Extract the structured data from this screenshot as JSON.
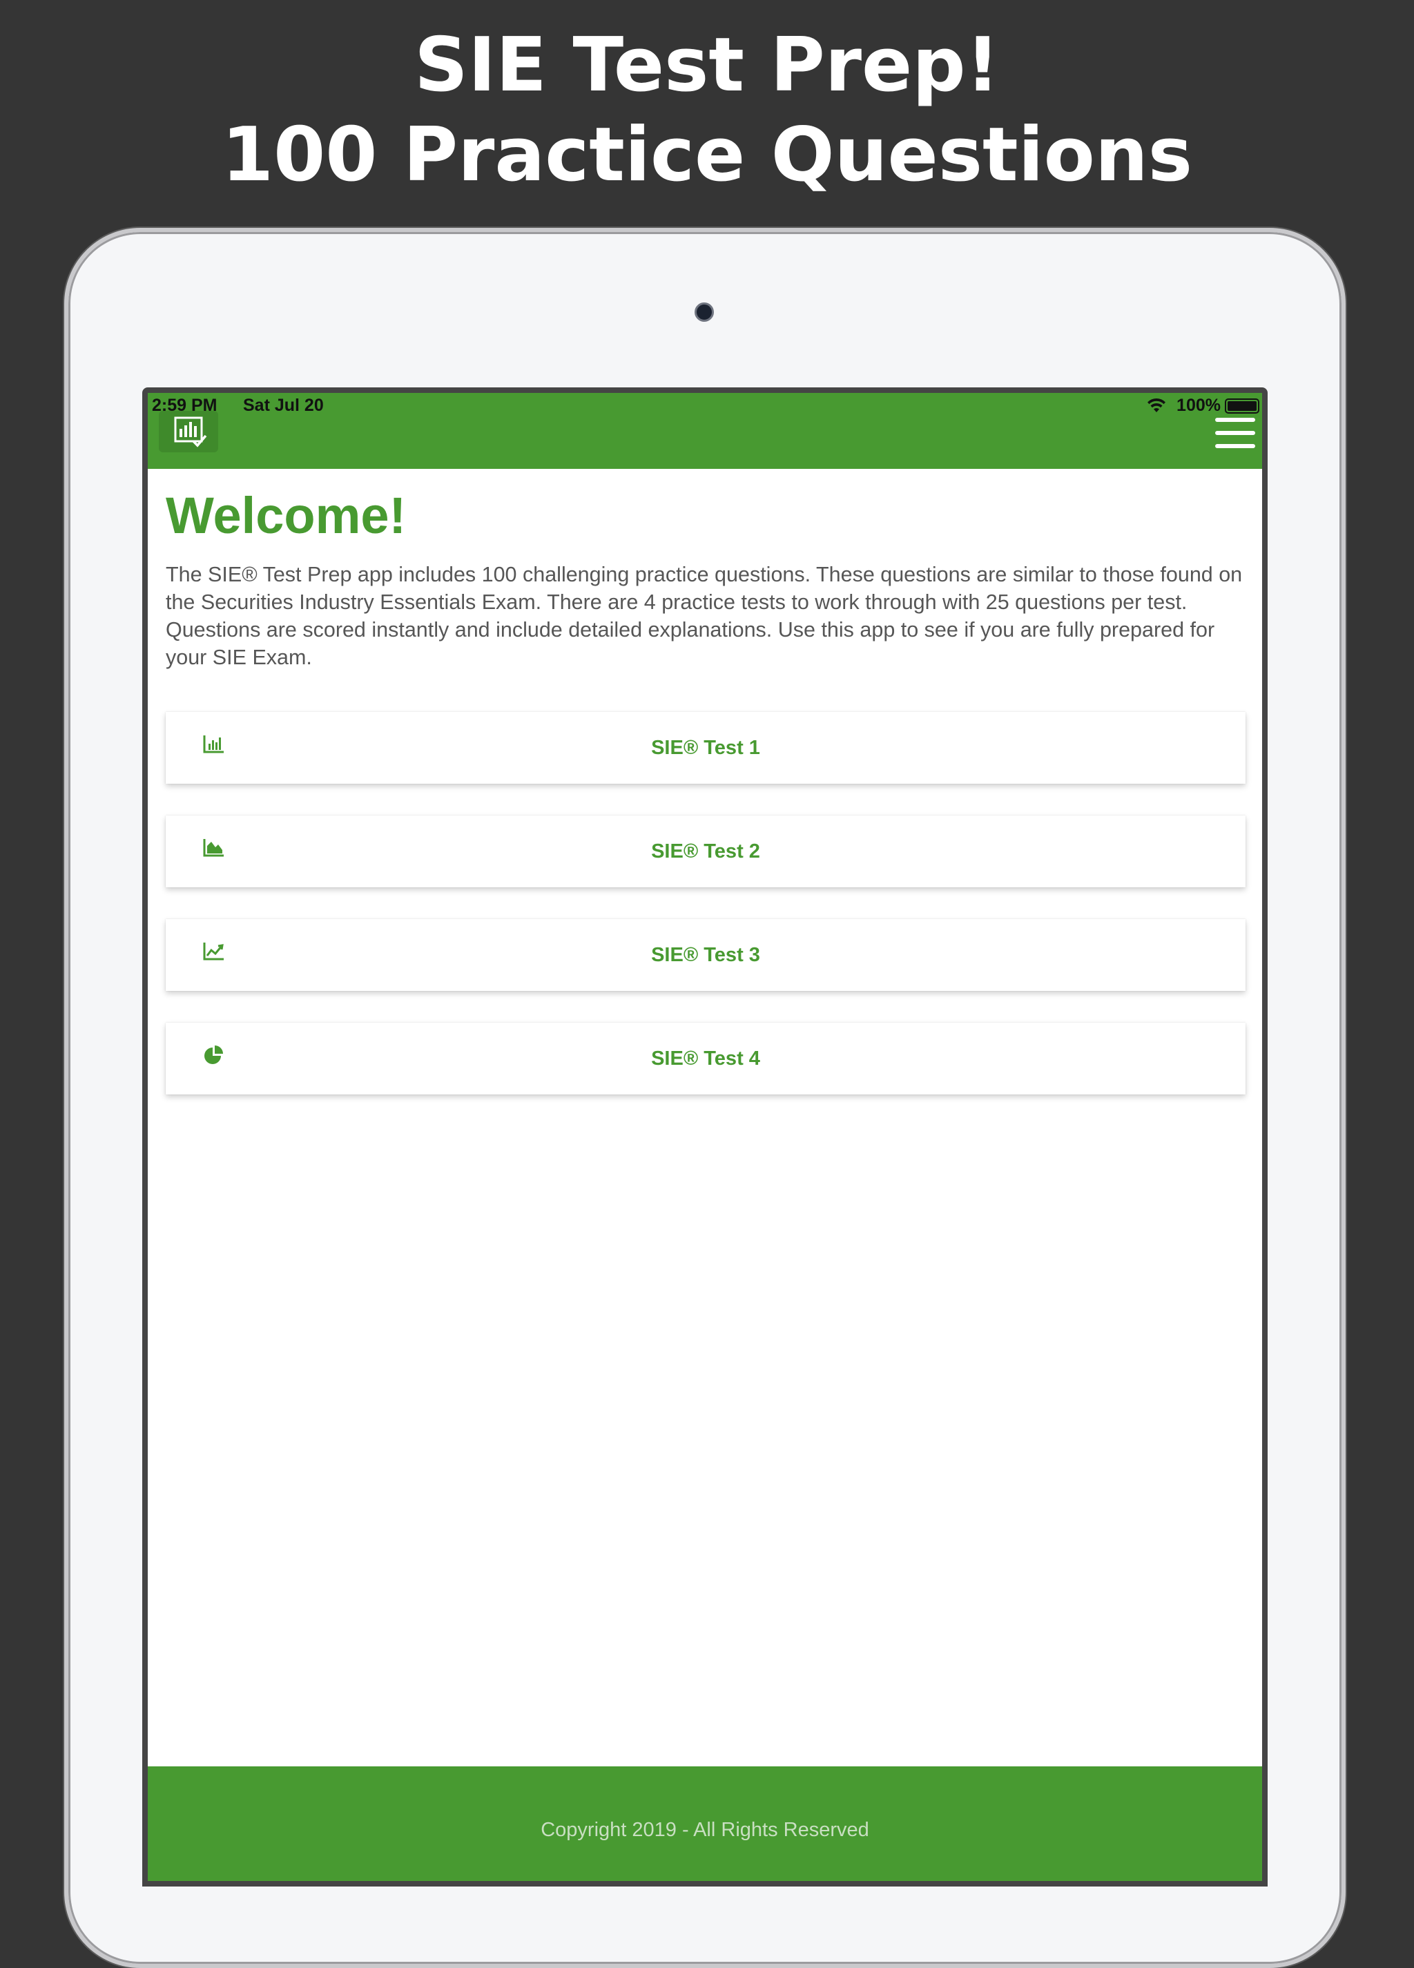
{
  "promo": {
    "line1": "SIE Test Prep!",
    "line2": "100 Practice Questions"
  },
  "status_bar": {
    "time": "2:59 PM",
    "date": "Sat Jul 20",
    "battery_percent": "100%",
    "wifi_icon": "wifi-icon",
    "battery_icon": "battery-full-icon"
  },
  "header": {
    "logo_icon": "bar-chart-check-logo-icon",
    "menu_icon": "hamburger-menu-icon",
    "background_color": "#489a31"
  },
  "main": {
    "title": "Welcome!",
    "intro": "The SIE® Test Prep app includes 100 challenging practice questions. These questions are similar to those found on the Securities Industry Essentials Exam. There are 4 practice tests to work through with 25 questions per test. Questions are scored instantly and include detailed explanations. Use this app to see if you are fully prepared for your SIE Exam.",
    "tests": [
      {
        "label": "SIE® Test 1",
        "icon": "bar-chart-icon"
      },
      {
        "label": "SIE® Test 2",
        "icon": "area-chart-icon"
      },
      {
        "label": "SIE® Test 3",
        "icon": "line-chart-icon"
      },
      {
        "label": "SIE® Test 4",
        "icon": "pie-chart-icon"
      }
    ]
  },
  "footer": {
    "copyright": "Copyright 2019 - All Rights Reserved"
  },
  "colors": {
    "accent": "#489a31",
    "background": "#353535",
    "text": "#565656"
  }
}
